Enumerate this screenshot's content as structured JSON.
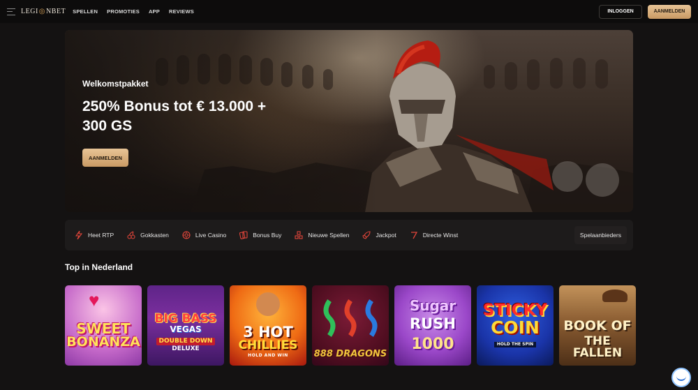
{
  "header": {
    "logo": {
      "left": "LEGI",
      "mark": "◎",
      "right": "NBET"
    },
    "nav": [
      "SPELLEN",
      "PROMOTIES",
      "APP",
      "REVIEWS"
    ],
    "login_label": "INLOGGEN",
    "register_label": "AANMELDEN"
  },
  "hero": {
    "subtitle": "Welkomstpakket",
    "title": "250% Bonus tot € 13.000 + 300 GS",
    "cta_label": "AANMELDEN"
  },
  "categories": [
    {
      "label": "Heet RTP",
      "icon": "flash-icon"
    },
    {
      "label": "Gokkasten",
      "icon": "cherries-icon"
    },
    {
      "label": "Live Casino",
      "icon": "chip-icon"
    },
    {
      "label": "Bonus Buy",
      "icon": "cards-icon"
    },
    {
      "label": "Nieuwe Spellen",
      "icon": "blocks-icon"
    },
    {
      "label": "Jackpot",
      "icon": "rocket-icon"
    },
    {
      "label": "Directe Winst",
      "icon": "seven-icon"
    }
  ],
  "providers_label": "Spelaanbieders",
  "section_title": "Top in Nederland",
  "games": [
    {
      "name": "Sweet Bonanza",
      "lines": [
        "SWEET",
        "BONANZA"
      ]
    },
    {
      "name": "Big Bass Vegas Double Down Deluxe",
      "lines": [
        "BIG BASS",
        "VEGAS",
        "DOUBLE DOWN",
        "DELUXE"
      ]
    },
    {
      "name": "3 Hot Chillies",
      "lines": [
        "3 HOT",
        "CHILLIES",
        "HOLD AND WIN"
      ]
    },
    {
      "name": "888 Dragons",
      "lines": [
        "888 DRAGONS"
      ]
    },
    {
      "name": "Sugar Rush 1000",
      "lines": [
        "Sugar",
        "RUSH",
        "1000"
      ]
    },
    {
      "name": "Sticky Coin",
      "lines": [
        "STICKY",
        "COIN",
        "HOLD THE SPIN"
      ]
    },
    {
      "name": "Book of the Fallen",
      "lines": [
        "BOOK OF",
        "THE FALLEN"
      ]
    }
  ],
  "colors": {
    "accent": "#e2453a",
    "gold": "#d9a86c",
    "background": "#141212"
  }
}
